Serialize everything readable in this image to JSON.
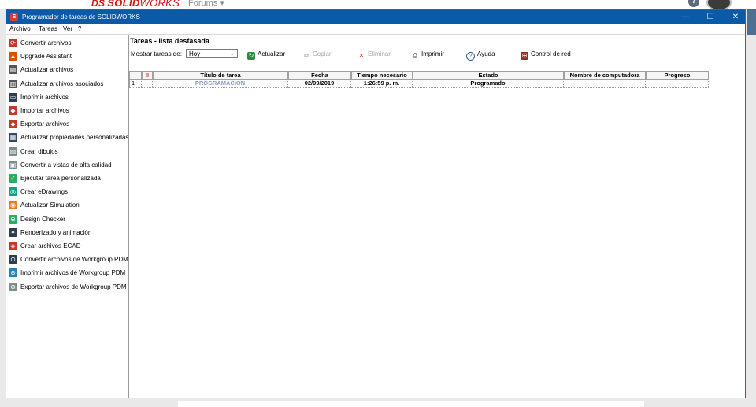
{
  "site": {
    "brand_prefix": "DS",
    "brand_bold": "SOLID",
    "brand_light": "WORKS",
    "forums_label": "Forums ▾",
    "help_label": "?"
  },
  "window": {
    "title": "Programador de tareas de SOLIDWORKS",
    "minimize": "—",
    "maximize": "☐",
    "close": "✕"
  },
  "menu": [
    "Archivo",
    "Tareas",
    "Ver",
    "?"
  ],
  "tasks": [
    {
      "label": "Convertir archivos",
      "icon": "convert-files-icon",
      "color": "#c0392b"
    },
    {
      "label": "Upgrade Assistant",
      "icon": "upgrade-assistant-icon",
      "color": "#d35400"
    },
    {
      "label": "Actualizar archivos",
      "icon": "update-files-icon",
      "color": "#555555"
    },
    {
      "label": "Actualizar archivos asociados",
      "icon": "update-associated-icon",
      "color": "#555555"
    },
    {
      "label": "Imprimir archivos",
      "icon": "print-files-icon",
      "color": "#2c3e50"
    },
    {
      "label": "Importar archivos",
      "icon": "import-files-icon",
      "color": "#c0392b"
    },
    {
      "label": "Exportar archivos",
      "icon": "export-files-icon",
      "color": "#c0392b"
    },
    {
      "label": "Actualizar propiedades personalizadas",
      "icon": "custom-properties-icon",
      "color": "#34495e"
    },
    {
      "label": "Crear dibujos",
      "icon": "create-drawings-icon",
      "color": "#7f8c8d"
    },
    {
      "label": "Convertir a vistas de alta calidad",
      "icon": "high-quality-views-icon",
      "color": "#7f8c8d"
    },
    {
      "label": "Ejecutar tarea personalizada",
      "icon": "custom-task-icon",
      "color": "#27ae60"
    },
    {
      "label": "Crear eDrawings",
      "icon": "edrawings-icon",
      "color": "#16a085"
    },
    {
      "label": "Actualizar Simulation",
      "icon": "simulation-icon",
      "color": "#e67e22"
    },
    {
      "label": "Design Checker",
      "icon": "design-checker-icon",
      "color": "#27ae60"
    },
    {
      "label": "Renderizado y animación",
      "icon": "render-animation-icon",
      "color": "#2c3e50"
    },
    {
      "label": "Crear archivos ECAD",
      "icon": "ecad-icon",
      "color": "#c0392b"
    },
    {
      "label": "Convertir archivos de Workgroup PDM",
      "icon": "pdm-convert-icon",
      "color": "#2c3e50"
    },
    {
      "label": "Imprimir archivos de Workgroup PDM",
      "icon": "pdm-print-icon",
      "color": "#2980b9"
    },
    {
      "label": "Exportar archivos de Workgroup PDM",
      "icon": "pdm-export-icon",
      "color": "#7f8c8d"
    }
  ],
  "main": {
    "pane_title": "Tareas - lista desfasada",
    "show_label": "Mostrar tareas de:",
    "show_value": "Hoy",
    "toolbar": {
      "refresh": "Actualizar",
      "copy": "Copiar",
      "delete": "Eliminar",
      "print": "Imprimir",
      "help": "Ayuda",
      "network": "Control de red"
    },
    "table": {
      "sort_icon": "‼",
      "headers": [
        "Título de tarea",
        "Fecha",
        "Tiempo necesario",
        "Estado",
        "Nombre de computadora",
        "Progreso"
      ],
      "rows": [
        {
          "num": "1",
          "title": "PROGRAMACION",
          "date": "02/09/2019",
          "time": "1:26:59 p. m.",
          "status": "Programado",
          "computer": "",
          "progress": ""
        }
      ]
    }
  },
  "colors": {
    "titlebar": "#0b5aa8",
    "link_text": "#8a9bc7",
    "brand_red": "#d7141a"
  }
}
